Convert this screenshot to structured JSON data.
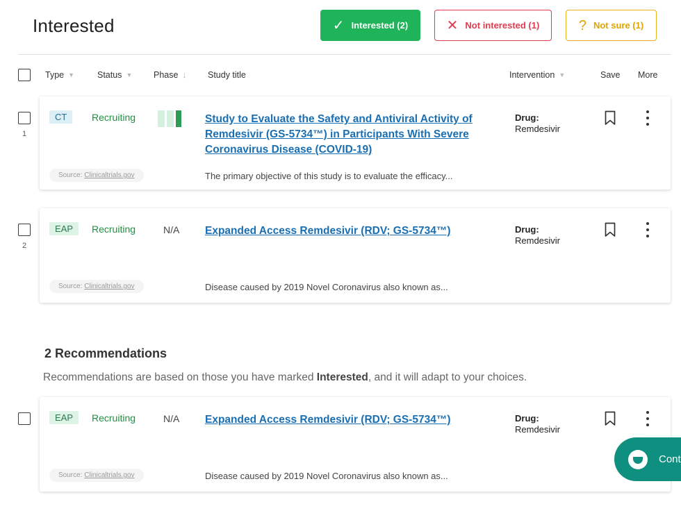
{
  "page": {
    "title": "Interested"
  },
  "filters": {
    "interested": {
      "label": "Interested (2)",
      "icon": "check-icon",
      "color": "#1fb35a"
    },
    "not_interested": {
      "label": "Not interested (1)",
      "icon": "x-icon",
      "color": "#e03b50"
    },
    "not_sure": {
      "label": "Not sure (1)",
      "icon": "question-icon",
      "color": "#e0a400"
    }
  },
  "columns": {
    "type": "Type",
    "status": "Status",
    "phase": "Phase",
    "study_title": "Study title",
    "intervention": "Intervention",
    "save": "Save",
    "more": "More"
  },
  "interested_rows": [
    {
      "num": "1",
      "type": "CT",
      "status": "Recruiting",
      "phase": "",
      "title": "Study to Evaluate the Safety and Antiviral Activity of Remdesivir (GS-5734™) in Participants With Severe Coronavirus Disease (COVID-19)",
      "drug_label": "Drug:",
      "drug": "Remdesivir",
      "source_prefix": "Source: ",
      "source_link": "Clinicaltrials.gov",
      "summary": "The primary objective of this study is to evaluate the efficacy..."
    },
    {
      "num": "2",
      "type": "EAP",
      "status": "Recruiting",
      "phase": "N/A",
      "title": "Expanded Access Remdesivir (RDV; GS-5734™)",
      "drug_label": "Drug:",
      "drug": "Remdesivir",
      "source_prefix": "Source: ",
      "source_link": "Clinicaltrials.gov",
      "summary": "Disease caused by 2019 Novel Coronavirus also known as..."
    }
  ],
  "recommendations": {
    "title": "2 Recommendations",
    "subtitle_pre": "Recommendations are based on those you have marked ",
    "subtitle_bold": "Interested",
    "subtitle_post": ", and it will adapt to your choices.",
    "rows": [
      {
        "type": "EAP",
        "status": "Recruiting",
        "phase": "N/A",
        "title": "Expanded Access Remdesivir (RDV; GS-5734™)",
        "drug_label": "Drug:",
        "drug": "Remdesivir",
        "source_prefix": "Source: ",
        "source_link": "Clinicaltrials.gov",
        "summary": "Disease caused by 2019 Novel Coronavirus also known as..."
      }
    ]
  },
  "contact": {
    "label": "Cont"
  }
}
